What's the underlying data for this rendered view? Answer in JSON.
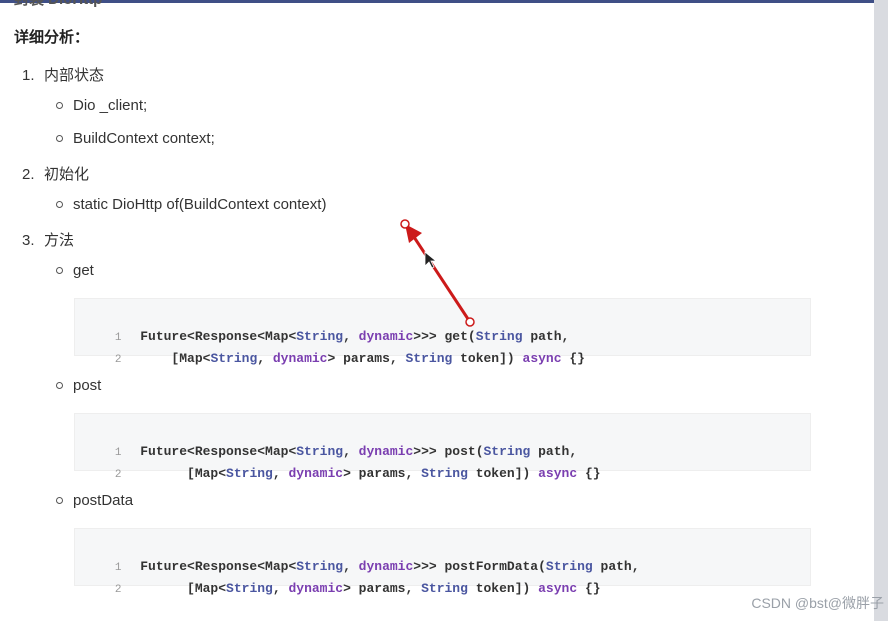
{
  "cut_title": "封装 DioHttp",
  "heading": "详细分析：",
  "sections": [
    {
      "num": "1.",
      "label": "内部状态",
      "items": [
        "Dio _client;",
        "BuildContext context;"
      ]
    },
    {
      "num": "2.",
      "label": "初始化",
      "items": [
        "static DioHttp of(BuildContext context)"
      ]
    },
    {
      "num": "3.",
      "label": "方法",
      "items": [
        "get",
        "post",
        "postData"
      ]
    }
  ],
  "code": {
    "get": {
      "line1_no": "1",
      "line2_no": "2",
      "l1_a": "Future<Response<Map<",
      "l1_b": "String",
      "l1_c": ", ",
      "l1_d": "dynamic",
      "l1_e": ">>> get(",
      "l1_f": "String",
      "l1_g": " path,",
      "l2_a": "    [Map<",
      "l2_b": "String",
      "l2_c": ", ",
      "l2_d": "dynamic",
      "l2_e": "> params, ",
      "l2_f": "String",
      "l2_g": " token]) ",
      "l2_h": "async",
      "l2_i": " {}"
    },
    "post": {
      "line1_no": "1",
      "line2_no": "2",
      "l1_a": "Future<Response<Map<",
      "l1_b": "String",
      "l1_c": ", ",
      "l1_d": "dynamic",
      "l1_e": ">>> post(",
      "l1_f": "String",
      "l1_g": " path,",
      "l2_a": "      [Map<",
      "l2_b": "String",
      "l2_c": ", ",
      "l2_d": "dynamic",
      "l2_e": "> params, ",
      "l2_f": "String",
      "l2_g": " token]) ",
      "l2_h": "async",
      "l2_i": " {}"
    },
    "postData": {
      "line1_no": "1",
      "line2_no": "2",
      "l1_a": "Future<Response<Map<",
      "l1_b": "String",
      "l1_c": ", ",
      "l1_d": "dynamic",
      "l1_e": ">>> postFormData(",
      "l1_f": "String",
      "l1_g": " path,",
      "l2_a": "      [Map<",
      "l2_b": "String",
      "l2_c": ", ",
      "l2_d": "dynamic",
      "l2_e": "> params, ",
      "l2_f": "String",
      "l2_g": " token]) ",
      "l2_h": "async",
      "l2_i": " {}"
    }
  },
  "watermark": "CSDN @bst@微胖子",
  "colors": {
    "keyword": "#7a3eb0",
    "type": "#4a56a0",
    "annotation_arrow": "#cc1a1a",
    "frame": "#3f4f86"
  }
}
